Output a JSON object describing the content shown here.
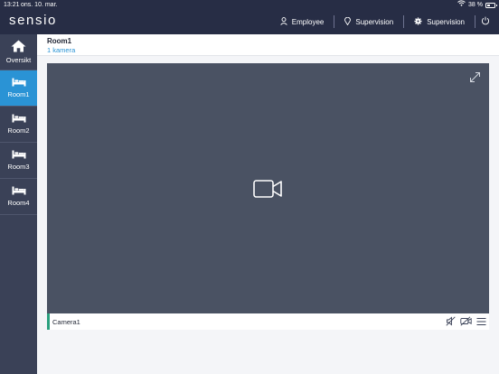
{
  "status_bar": {
    "time": "13:21",
    "date": "ons. 10. mar.",
    "battery": "38 %"
  },
  "app": {
    "brand": "sensio"
  },
  "header_nav": {
    "employee_label": "Employee",
    "supervision_location_label": "Supervision",
    "supervision_settings_label": "Supervision"
  },
  "sidebar": {
    "items": [
      {
        "label": "Oversikt",
        "icon": "home-icon"
      },
      {
        "label": "Room1",
        "icon": "bed-icon",
        "active": true
      },
      {
        "label": "Room2",
        "icon": "bed-icon"
      },
      {
        "label": "Room3",
        "icon": "bed-icon"
      },
      {
        "label": "Room4",
        "icon": "bed-icon"
      }
    ]
  },
  "room": {
    "title": "Room1",
    "subtitle": "1 kamera"
  },
  "camera": {
    "name": "Camera1"
  },
  "colors": {
    "header_bg": "#272d45",
    "sidebar_bg": "#3a4157",
    "active_accent": "#2a93d5",
    "video_bg": "#4a5263",
    "camera_indicator": "#2aa07e"
  }
}
